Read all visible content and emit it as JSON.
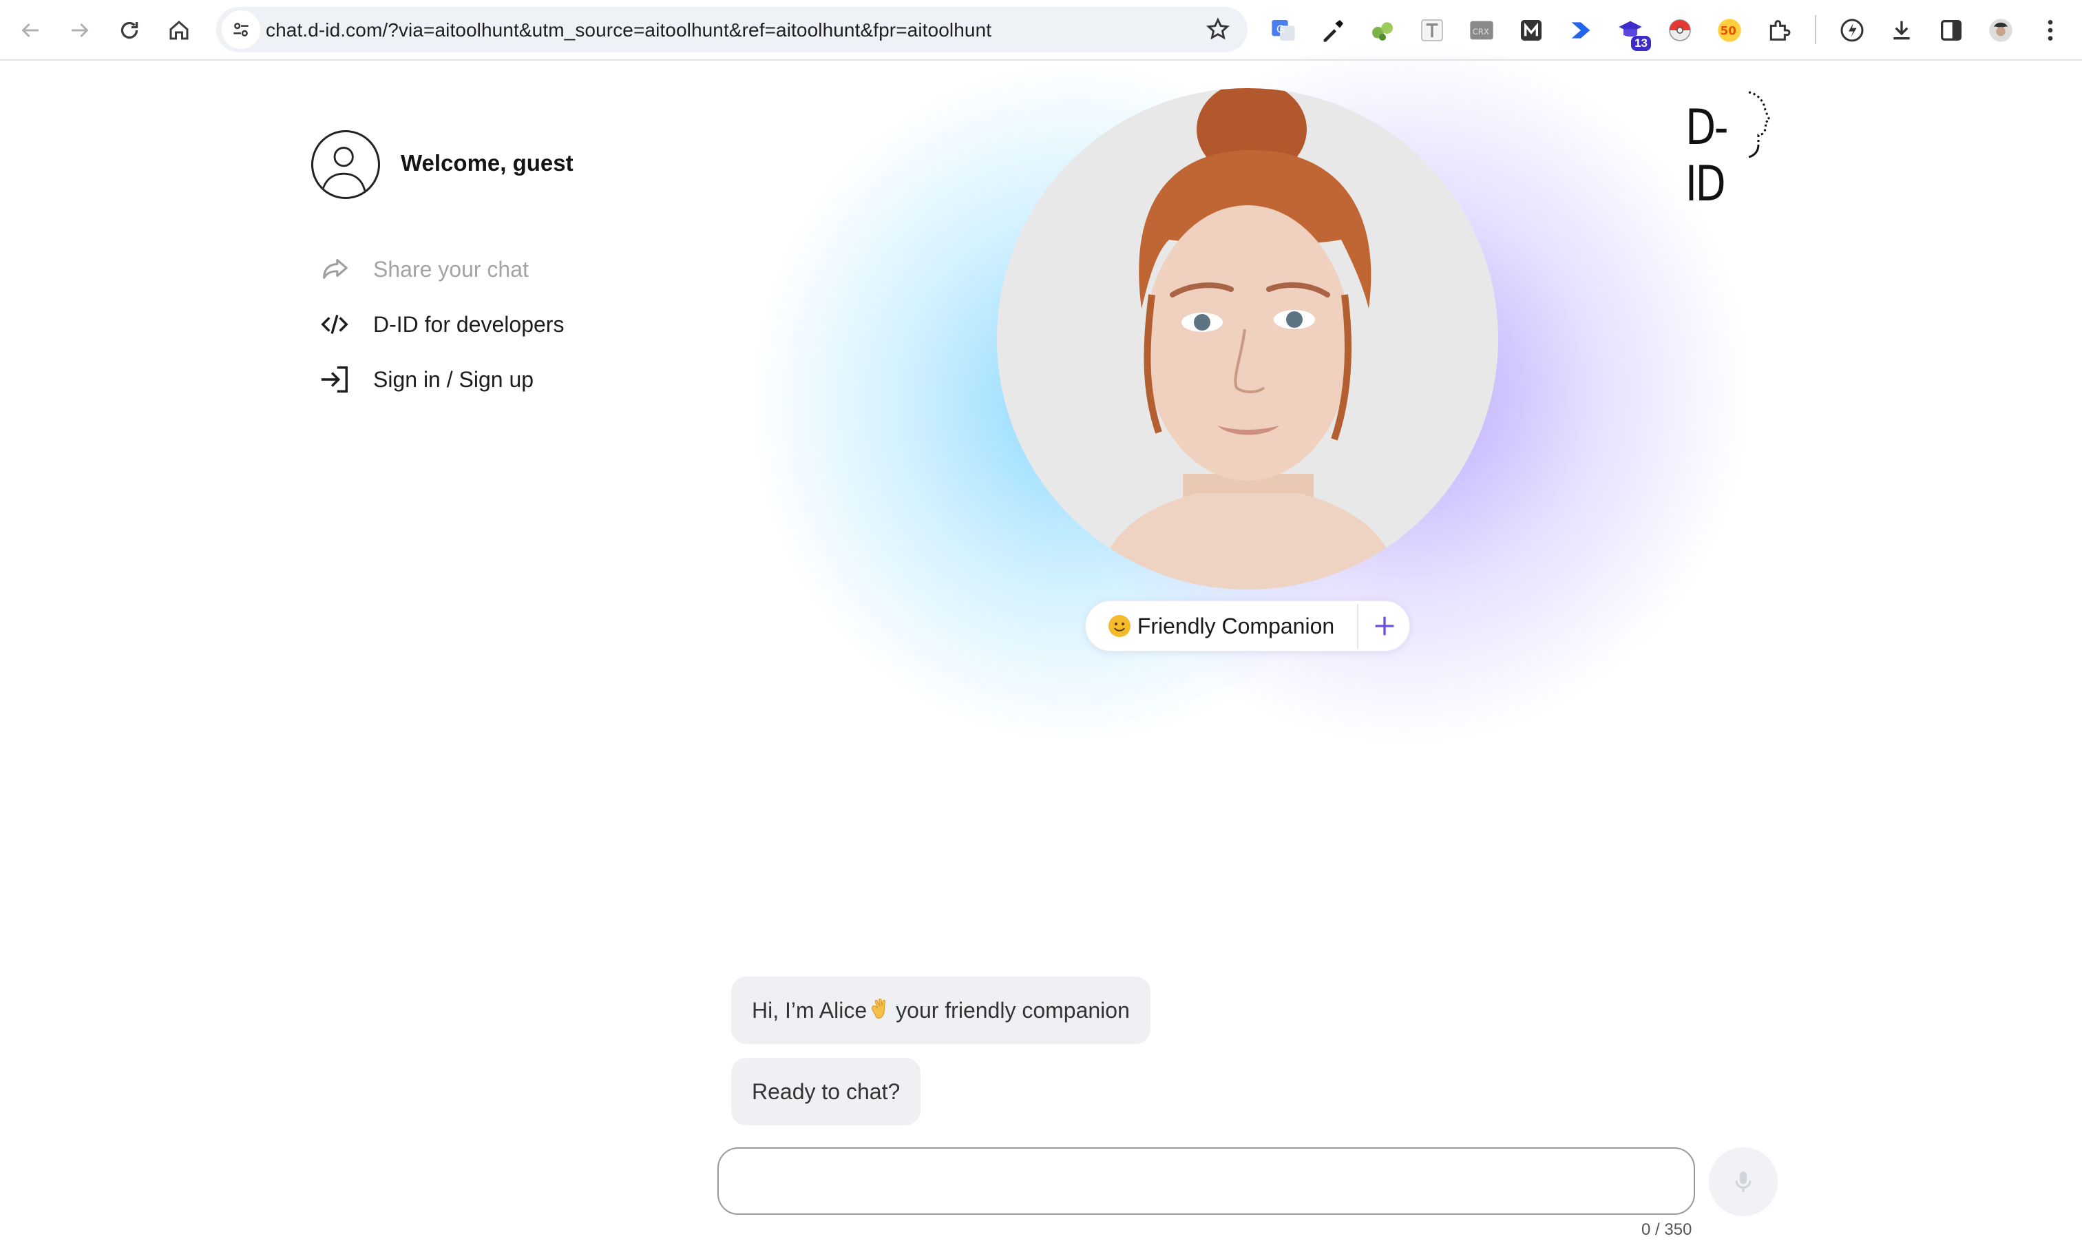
{
  "browser": {
    "url": "chat.d-id.com/?via=aitoolhunt&utm_source=aitoolhunt&ref=aitoolhunt&fpr=aitoolhunt",
    "nav_icons": [
      "back-arrow-icon",
      "forward-arrow-icon",
      "reload-icon",
      "home-icon"
    ],
    "extensions": [
      {
        "name": "google-translate-extension-icon"
      },
      {
        "name": "color-picker-extension-icon"
      },
      {
        "name": "frog-extension-icon"
      },
      {
        "name": "text-extension-icon"
      },
      {
        "name": "crx-extension-icon",
        "label": "CRX"
      },
      {
        "name": "m-extension-icon",
        "label": "M"
      },
      {
        "name": "arrow-extension-icon"
      },
      {
        "name": "graduation-extension-icon",
        "badge": "13"
      },
      {
        "name": "pokeball-extension-icon"
      },
      {
        "name": "50-extension-icon",
        "label": "50"
      },
      {
        "name": "puzzle-extensions-icon"
      },
      {
        "name": "bolt-extension-icon"
      },
      {
        "name": "download-icon"
      },
      {
        "name": "side-panel-icon"
      },
      {
        "name": "profile-icon"
      },
      {
        "name": "more-menu-icon"
      }
    ]
  },
  "sidebar": {
    "welcome": "Welcome, guest",
    "items": [
      {
        "label": "Share your chat",
        "icon": "share-icon",
        "enabled": false
      },
      {
        "label": "D-ID for developers",
        "icon": "code-icon",
        "enabled": true
      },
      {
        "label": "Sign in / Sign up",
        "icon": "sign-in-icon",
        "enabled": true
      }
    ]
  },
  "logo": {
    "text": "D-ID"
  },
  "persona": {
    "label": "Friendly Companion",
    "emoji": "smiling-face-emoji"
  },
  "chat": {
    "messages": [
      {
        "before": "Hi, I’m Alice",
        "emoji": "waving-hand-emoji",
        "after": "your friendly companion"
      },
      {
        "text": "Ready to chat?"
      }
    ],
    "input_value": "",
    "char_count": "0 / 350"
  },
  "colors": {
    "glow_blue": "#78d2ff",
    "glow_purple": "#aa96ff",
    "accent": "#6c4ce0",
    "bubble_bg": "#eff0f3"
  }
}
